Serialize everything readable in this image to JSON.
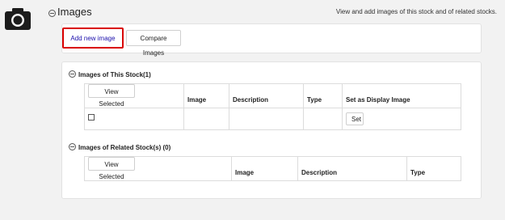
{
  "header": {
    "title": "Images",
    "description": "View and add images of this stock and of related stocks."
  },
  "toolbar": {
    "add_label": "Add new image",
    "compare_label": "Compare Images"
  },
  "this_stock": {
    "title": "Images of This Stock(1)",
    "view_selected_label": "View Selected",
    "columns": [
      "Image",
      "Description",
      "Type",
      "Set as Display Image"
    ],
    "rows": [
      {
        "image": "",
        "description": "",
        "type": "",
        "set_label": "Set"
      }
    ]
  },
  "related_stocks": {
    "title": "Images of Related Stock(s) (0)",
    "view_selected_label": "View Selected",
    "columns": [
      "Image",
      "Description",
      "Type"
    ]
  },
  "colors": {
    "highlight_border": "#d90000",
    "link": "#1a0dab",
    "background": "#f2f2f2"
  },
  "icons": {
    "section": "camera-icon",
    "collapse": "collapse-circle-icon"
  }
}
